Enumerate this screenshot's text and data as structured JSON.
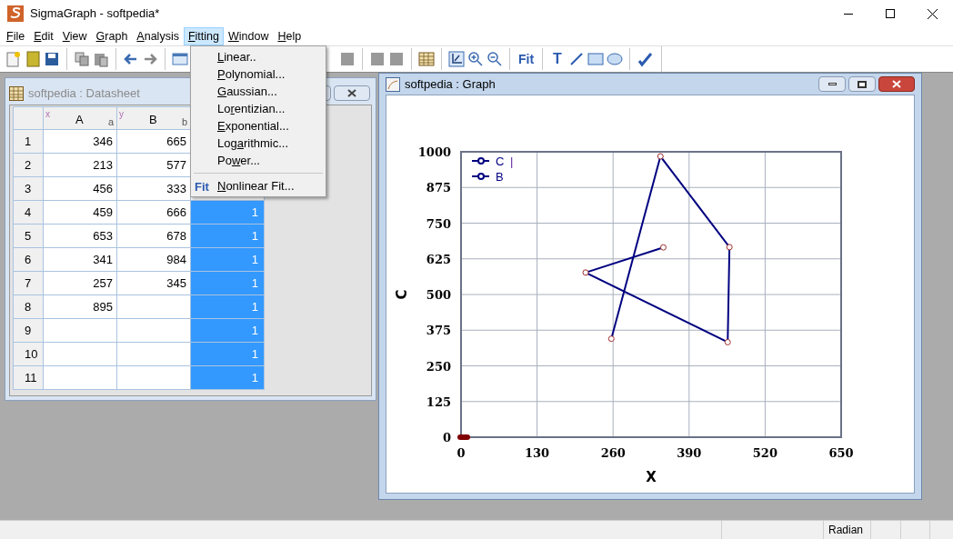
{
  "window": {
    "title": "SigmaGraph - softpedia*"
  },
  "menu_bar": [
    {
      "key": "F",
      "post": "ile",
      "selected": false
    },
    {
      "key": "E",
      "post": "dit",
      "selected": false
    },
    {
      "key": "V",
      "post": "iew",
      "selected": false
    },
    {
      "key": "G",
      "post": "raph",
      "selected": false
    },
    {
      "key": "A",
      "post": "nalysis",
      "selected": false
    },
    {
      "key": "F",
      "post": "itting",
      "selected": true
    },
    {
      "key": "W",
      "post": "indow",
      "selected": false
    },
    {
      "key": "H",
      "post": "elp",
      "selected": false
    }
  ],
  "toolbar": {
    "fit_label": "Fit",
    "text_tool_label": "T"
  },
  "fitting_menu": [
    {
      "key": "L",
      "post": "inear..",
      "kind": "item"
    },
    {
      "key": "P",
      "post": "olynomial...",
      "kind": "item"
    },
    {
      "key": "G",
      "post": "aussian...",
      "kind": "item"
    },
    {
      "pre": "Lo",
      "key": "r",
      "post": "entizian...",
      "kind": "item"
    },
    {
      "key": "E",
      "post": "xponential...",
      "kind": "item"
    },
    {
      "pre": "Log",
      "key": "a",
      "post": "rithmic...",
      "kind": "item"
    },
    {
      "pre": "Po",
      "key": "w",
      "post": "er...",
      "kind": "item"
    },
    {
      "kind": "separator"
    },
    {
      "key": "N",
      "post": "onlinear Fit...",
      "kind": "item",
      "icon_text": "Fit"
    }
  ],
  "datasheet": {
    "title": "softpedia : Datasheet",
    "active": false,
    "columns": [
      {
        "axis": "x",
        "name": "A",
        "sub": "a"
      },
      {
        "axis": "y",
        "name": "B",
        "sub": "b"
      }
    ],
    "rows": [
      {
        "n": "1",
        "a": "346",
        "b": "665"
      },
      {
        "n": "2",
        "a": "213",
        "b": "577"
      },
      {
        "n": "3",
        "a": "456",
        "b": "333"
      },
      {
        "n": "4",
        "a": "459",
        "b": "666",
        "c": "1",
        "selected": true
      },
      {
        "n": "5",
        "a": "653",
        "b": "678",
        "c": "1",
        "selected": true
      },
      {
        "n": "6",
        "a": "341",
        "b": "984",
        "c": "1",
        "selected": true
      },
      {
        "n": "7",
        "a": "257",
        "b": "345",
        "c": "1",
        "selected": true
      },
      {
        "n": "8",
        "a": "895",
        "c": "1",
        "selected": true
      },
      {
        "n": "9",
        "c": "1",
        "selected": true
      },
      {
        "n": "10",
        "c": "1",
        "selected": true
      },
      {
        "n": "11",
        "c": "1",
        "selected": true
      }
    ]
  },
  "graph": {
    "title": "softpedia : Graph",
    "active": true,
    "legend": [
      {
        "name": "C"
      }
    ],
    "cursor_text": "|",
    "chart_data": {
      "type": "line",
      "xlabel": "X",
      "ylabel": "C",
      "grid": true,
      "x": [
        346,
        213,
        456,
        459,
        341,
        257
      ],
      "series": [
        {
          "name": "B",
          "color": "#000080",
          "marker": "circle",
          "values": [
            665,
            577,
            333,
            666,
            984,
            345
          ]
        }
      ],
      "xlim": [
        0,
        650
      ],
      "ylim": [
        0,
        1000
      ],
      "xticks": [
        0,
        130,
        260,
        390,
        520,
        650
      ],
      "yticks": [
        0,
        125,
        250,
        375,
        500,
        625,
        750,
        875,
        1000
      ]
    }
  },
  "status_bar": {
    "angle_unit": "Radian"
  }
}
